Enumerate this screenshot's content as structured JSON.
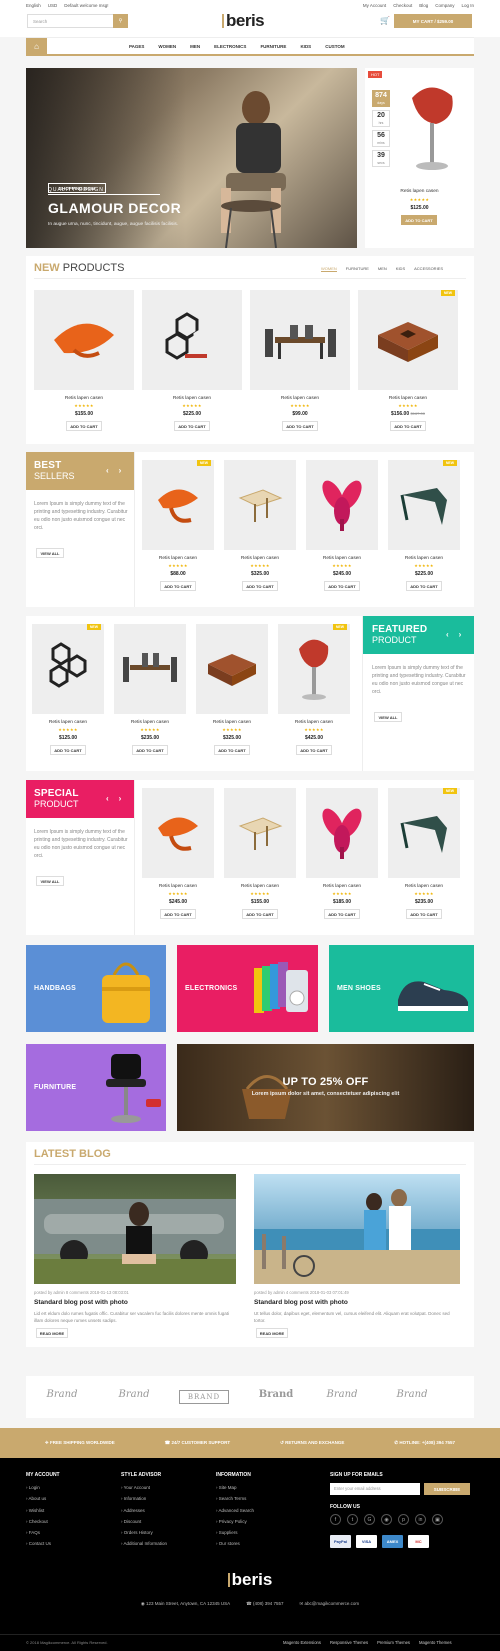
{
  "topbar": {
    "language": "English",
    "currency": "USD",
    "welcome": "Default welcome msg!",
    "links": [
      "My Account",
      "Checkout",
      "Blog",
      "Company",
      "Log In"
    ]
  },
  "header": {
    "search_placeholder": "Search",
    "logo": "beris",
    "cart": "MY CART / $259.00"
  },
  "nav": {
    "items": [
      "PAGES",
      "WOMEN",
      "MEN",
      "ELECTRONICS",
      "FURNITURE",
      "KIDS",
      "CUSTOM"
    ]
  },
  "hero": {
    "tag": "QUALITY DESIGN",
    "title": "GLAMOUR DECOR",
    "desc": "In augue urna, nunc, tincidunt, augue, augue facilisis facilisis.",
    "button": "SHOPPING NOW"
  },
  "deal": {
    "badge": "HOT",
    "countdown": [
      {
        "v": "874",
        "u": "days"
      },
      {
        "v": "20",
        "u": "hrs"
      },
      {
        "v": "56",
        "u": "mins"
      },
      {
        "v": "39",
        "u": "secs"
      }
    ],
    "name": "Retis lapen casen",
    "price": "$125.00",
    "button": "ADD TO CART"
  },
  "new_products": {
    "title_a": "NEW",
    "title_b": "PRODUCTS",
    "tabs": [
      "WOMEN",
      "FURNITURE",
      "MEN",
      "KIDS",
      "ACCESSORIES"
    ],
    "items": [
      {
        "name": "Retis lapen casen",
        "price": "$155.00",
        "old": "",
        "new": ""
      },
      {
        "name": "Retis lapen casen",
        "price": "$225.00",
        "old": "",
        "new": ""
      },
      {
        "name": "Retis lapen casen",
        "price": "$99.00",
        "old": "",
        "new": ""
      },
      {
        "name": "Retis lapen casen",
        "price": "$156.00",
        "old": "$167.00",
        "new": "NEW"
      }
    ]
  },
  "common": {
    "add": "ADD TO CART",
    "view_all": "VIEW ALL",
    "promo_text": "Lorem Ipsum is simply dummy text of the printing and typesetting industry. Curabitur eu odio non justo euismod congue ut nec orci.",
    "stars": "★★★★★"
  },
  "best": {
    "t1": "BEST",
    "t2": "SELLERS",
    "items": [
      {
        "name": "Retis lapen casen",
        "price": "$88.00",
        "new": "NEW"
      },
      {
        "name": "Retis lapen casen",
        "price": "$325.00",
        "new": ""
      },
      {
        "name": "Retis lapen casen",
        "price": "$245.00",
        "new": ""
      },
      {
        "name": "Retis lapen casen",
        "price": "$225.00",
        "new": "NEW"
      }
    ]
  },
  "featured": {
    "t1": "FEATURED",
    "t2": "PRODUCT",
    "items": [
      {
        "name": "Retis lapen casen",
        "price": "$125.00",
        "new": "NEW"
      },
      {
        "name": "Retis lapen casen",
        "price": "$235.00",
        "new": ""
      },
      {
        "name": "Retis lapen casen",
        "price": "$325.00",
        "new": ""
      },
      {
        "name": "Retis lapen casen",
        "price": "$425.00",
        "new": "NEW"
      }
    ]
  },
  "special": {
    "t1": "SPECIAL",
    "t2": "PRODUCT",
    "items": [
      {
        "name": "Retis lapen casen",
        "price": "$245.00",
        "new": ""
      },
      {
        "name": "Retis lapen casen",
        "price": "$155.00",
        "new": ""
      },
      {
        "name": "Retis lapen casen",
        "price": "$185.00",
        "new": ""
      },
      {
        "name": "Retis lapen casen",
        "price": "$235.00",
        "new": "NEW"
      }
    ]
  },
  "categories": {
    "handbags": "HANDBAGS",
    "electronics": "ELECTRONICS",
    "men_shoes": "MEN SHOES",
    "furniture": "FURNITURE",
    "sale_title": "UP TO 25% OFF",
    "sale_sub": "Lorem ipsum dolor sit amet, consectetuer adipiscing elit"
  },
  "blog": {
    "title_a": "LATEST",
    "title_b": "BLOG",
    "posts": [
      {
        "meta": "posted by admin   8 comments   2018-01-13 08:03:01",
        "title": "Standard blog post with photo",
        "desc": "Lid ert eldum dolo rumes fugatis offic. Curabitur ser vacalem fuc facilis dolores mente omnis fugati illam dolores neque rumes unsets sadips.",
        "more": "READ MORE"
      },
      {
        "meta": "posted by admin   4 comments   2018-01-03 07:01:49",
        "title": "Standard blog post with photo",
        "desc": "Ut tellus dolor, dapibus eget, elementum vel, cursus eleifend elit. Aliquam erat volutpat. Donec sed tortor.",
        "more": "READ MORE"
      }
    ]
  },
  "brands": [
    "Brand",
    "Brand",
    "BRAND",
    "Brand",
    "Brand",
    "Brand"
  ],
  "service": [
    "FREE SHIPPING WORLDWIDE",
    "24/7 CUSTOMER SUPPORT",
    "RETURNS AND EXCHANGE",
    "HOTLINE: +(408) 394 7557"
  ],
  "footer": {
    "c1": {
      "h": "MY ACCOUNT",
      "items": [
        "Login",
        "About us",
        "Wishlist",
        "Checkout",
        "FAQs",
        "Contact Us"
      ]
    },
    "c2": {
      "h": "STYLE ADVISOR",
      "items": [
        "Your Account",
        "Information",
        "Addresses",
        "Discount",
        "Orders History",
        "Additional Information"
      ]
    },
    "c3": {
      "h": "INFORMATION",
      "items": [
        "Site Map",
        "Search Terms",
        "Advanced Search",
        "Privacy Policy",
        "Suppliers",
        "Our stores"
      ]
    },
    "signup": "SIGN UP FOR EMAILS",
    "email_ph": "Enter your email address",
    "subscribe": "SUBSCRIBE",
    "follow": "FOLLOW US",
    "pay": [
      "PayPal",
      "VISA",
      "AMEX",
      "MC"
    ],
    "logo": "beris",
    "address": "123 Main Street, Anytown, CA 12345 USA",
    "phone": "(408) 394 7557",
    "email": "abc@magikcommerce.com",
    "copyright": "© 2018 Magikcommerce. All Rights Reserved.",
    "links": [
      "Magento Extensions",
      "Responsive Themes",
      "Premium Themes",
      "Magento Themes"
    ]
  }
}
